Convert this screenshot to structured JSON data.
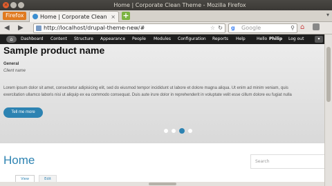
{
  "window": {
    "title": "Home | Corporate Clean Theme - Mozilla Firefox"
  },
  "browser": {
    "menu_label": "Firefox",
    "tab_title": "Home | Corporate Clean Theme",
    "tab_close": "×",
    "new_tab": "+",
    "url": "http://localhost/drupal-theme-new/#",
    "search_engine": "g",
    "search_placeholder": "Google",
    "icons": {
      "back": "back-arrow-icon",
      "forward": "forward-arrow-icon",
      "reload": "reload-icon",
      "bookmark": "star-icon",
      "search": "magnifier-icon",
      "home": "home-icon"
    }
  },
  "toolbar": {
    "home_icon": "⌂",
    "items": [
      "Dashboard",
      "Content",
      "Structure",
      "Appearance",
      "People",
      "Modules",
      "Configuration",
      "Reports",
      "Help"
    ],
    "hello": "Hello",
    "user": "Philip",
    "logout": "Log out"
  },
  "slide": {
    "title": "Sample product name",
    "general_label": "General",
    "client_label": "Client name",
    "body_line1": "Lorem ipsum dolor sit amet, consectetur adipisicing elit, sed do eiusmod tempor incididunt ut labore et dolore magna aliqua. Ut enim ad minim veniam, quis",
    "body_line2": "exercitation ullamco laboris nisi ut aliquip ex ea commodo consequat. Duis aute irure dolor in reprehenderit in voluptate velit esse cillum dolore eu fugiat nulla",
    "button_label": "Tell me more",
    "dots_count": 4,
    "active_dot_index": 2
  },
  "page": {
    "title": "Home",
    "search_placeholder": "Search",
    "tabs": [
      "View",
      "Edit"
    ]
  },
  "colors": {
    "accent": "#2d83b2",
    "toolbar_bg": "#1e1e1e",
    "firefox_orange": "#e07a1f"
  }
}
